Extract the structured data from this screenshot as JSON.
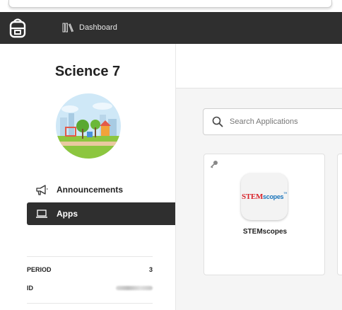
{
  "header": {
    "dashboard_label": "Dashboard"
  },
  "sidebar": {
    "course_title": "Science 7",
    "nav": [
      {
        "label": "Announcements",
        "icon": "megaphone-icon",
        "active": false
      },
      {
        "label": "Apps",
        "icon": "laptop-icon",
        "active": true
      }
    ],
    "info": [
      {
        "label": "PERIOD",
        "value": "3"
      },
      {
        "label": "ID",
        "value": ""
      }
    ]
  },
  "main": {
    "search": {
      "placeholder": "Search Applications",
      "value": ""
    },
    "apps": [
      {
        "name": "STEMscopes",
        "logo_text_a": "STEM",
        "logo_text_b": "scopes",
        "logo_text_c": "™"
      }
    ]
  },
  "colors": {
    "header_bg": "#2f2f2f",
    "active_nav_bg": "#2f2f2f",
    "main_bg": "#f5f5f5",
    "stem_red": "#d8232a",
    "stem_blue": "#1b75bb"
  }
}
